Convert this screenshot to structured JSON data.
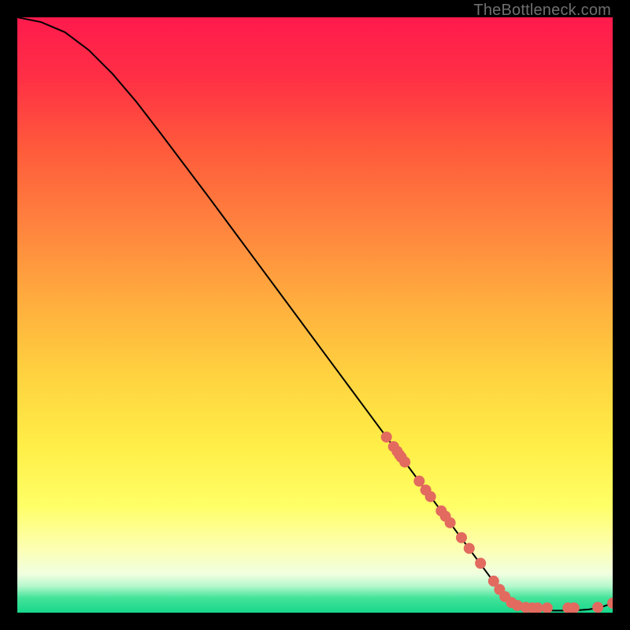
{
  "watermark": "TheBottleneck.com",
  "chart_data": {
    "type": "line",
    "title": "",
    "xlabel": "",
    "ylabel": "",
    "xlim": [
      0,
      100
    ],
    "ylim": [
      0,
      100
    ],
    "curve": {
      "x": [
        0,
        4,
        8,
        12,
        16,
        20,
        24,
        28,
        32,
        36,
        40,
        44,
        48,
        52,
        56,
        60,
        64,
        68,
        72,
        76,
        80,
        82,
        84,
        86,
        88,
        90,
        92,
        94,
        96,
        98,
        100
      ],
      "y": [
        100,
        99.2,
        97.5,
        94.5,
        90.5,
        85.8,
        80.6,
        75.3,
        70.0,
        64.6,
        59.2,
        53.8,
        48.4,
        43.0,
        37.6,
        32.2,
        26.8,
        21.4,
        16.0,
        10.6,
        5.2,
        2.6,
        1.2,
        0.6,
        0.4,
        0.35,
        0.35,
        0.4,
        0.55,
        0.9,
        1.6
      ]
    },
    "dots": {
      "x": [
        62,
        63.2,
        63.8,
        64.2,
        64.5,
        65.1,
        67.5,
        68.6,
        69.4,
        71.2,
        71.9,
        72.7,
        74.6,
        75.9,
        77.8,
        80.0,
        81.0,
        81.9,
        83.0,
        84.0,
        85.4,
        86.5,
        87.4,
        89.0,
        92.5,
        93.5,
        97.5,
        100
      ],
      "y": [
        29.5,
        27.9,
        27.1,
        26.5,
        26.1,
        25.3,
        22.1,
        20.6,
        19.5,
        17.1,
        16.2,
        15.1,
        12.6,
        10.8,
        8.3,
        5.3,
        3.9,
        2.7,
        1.7,
        1.2,
        0.9,
        0.8,
        0.8,
        0.8,
        0.8,
        0.8,
        0.9,
        1.6
      ]
    },
    "gradient_stops": [
      {
        "offset": 0.0,
        "color": "#ff1a4d"
      },
      {
        "offset": 0.1,
        "color": "#ff2f45"
      },
      {
        "offset": 0.22,
        "color": "#ff5a3b"
      },
      {
        "offset": 0.35,
        "color": "#ff833e"
      },
      {
        "offset": 0.48,
        "color": "#ffae3e"
      },
      {
        "offset": 0.6,
        "color": "#ffd23f"
      },
      {
        "offset": 0.72,
        "color": "#ffee47"
      },
      {
        "offset": 0.82,
        "color": "#ffff66"
      },
      {
        "offset": 0.89,
        "color": "#fdffb0"
      },
      {
        "offset": 0.935,
        "color": "#f0ffe0"
      },
      {
        "offset": 0.955,
        "color": "#b7f8cd"
      },
      {
        "offset": 0.975,
        "color": "#44e39a"
      },
      {
        "offset": 1.0,
        "color": "#17d78b"
      }
    ],
    "dot_color": "#e26a5f",
    "curve_color": "#000000"
  }
}
